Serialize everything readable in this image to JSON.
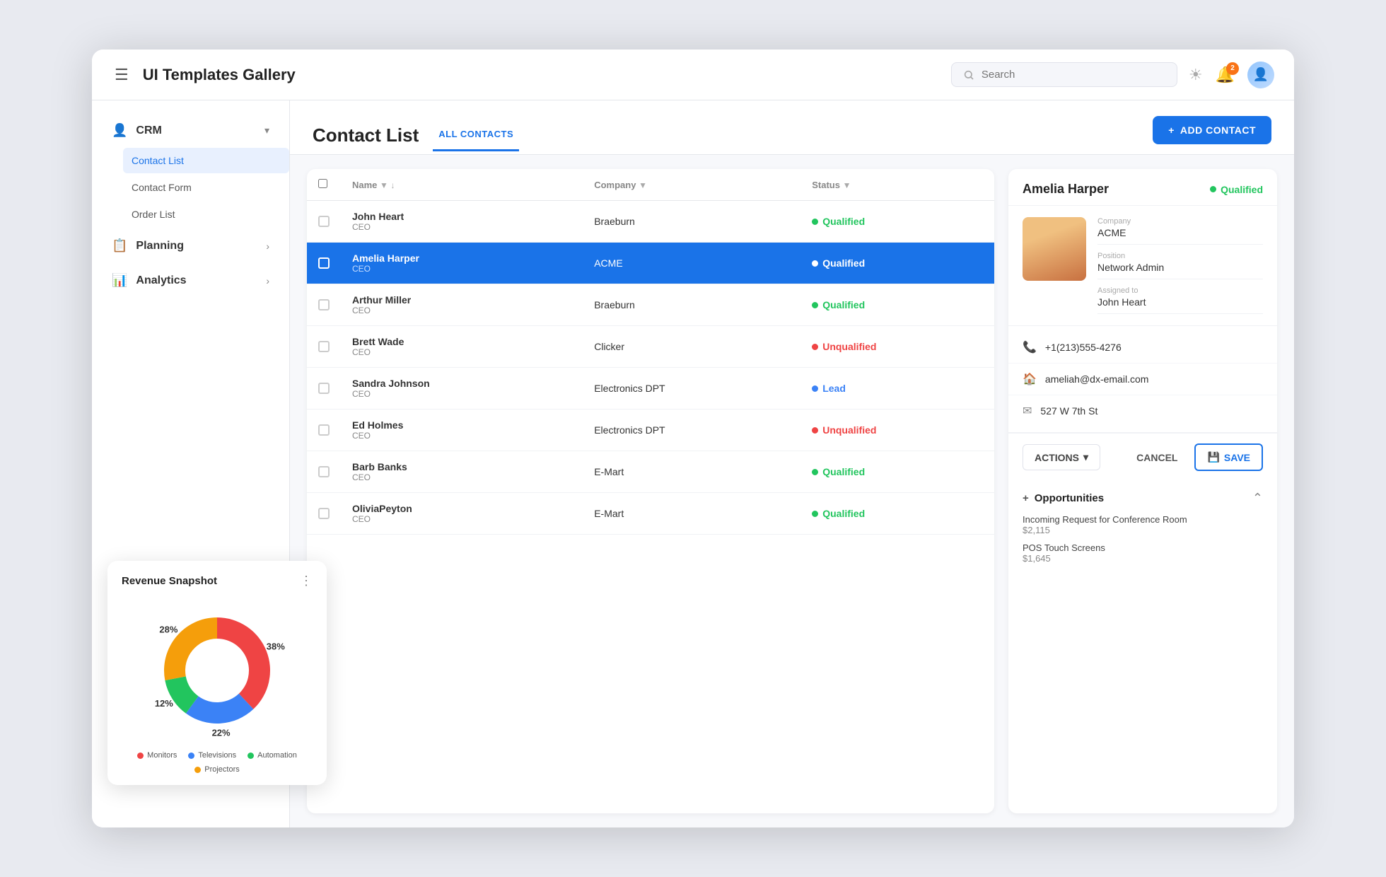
{
  "app": {
    "title": "UI Templates Gallery",
    "search_placeholder": "Search",
    "bell_badge": "2"
  },
  "sidebar": {
    "crm": {
      "label": "CRM",
      "items": [
        "Contact List",
        "Contact Form",
        "Order List"
      ]
    },
    "planning": {
      "label": "Planning"
    },
    "analytics": {
      "label": "Analytics"
    }
  },
  "main": {
    "title": "Contact List",
    "tab": "ALL CONTACTS",
    "add_button": "ADD CONTACT",
    "table": {
      "headers": [
        "Name",
        "Company",
        "Status"
      ],
      "rows": [
        {
          "name": "John Heart",
          "role": "CEO",
          "company": "Braeburn",
          "status": "Qualified",
          "status_type": "qualified"
        },
        {
          "name": "Amelia Harper",
          "role": "CEO",
          "company": "ACME",
          "status": "Qualified",
          "status_type": "qualified",
          "selected": true
        },
        {
          "name": "Arthur Miller",
          "role": "CEO",
          "company": "Braeburn",
          "status": "Qualified",
          "status_type": "qualified"
        },
        {
          "name": "Brett Wade",
          "role": "CEO",
          "company": "Clicker",
          "status": "Unqualified",
          "status_type": "unqualified"
        },
        {
          "name": "Sandra Johnson",
          "role": "CEO",
          "company": "Electronics DPT",
          "status": "Lead",
          "status_type": "lead"
        },
        {
          "name": "Ed Holmes",
          "role": "CEO",
          "company": "Electronics DPT",
          "status": "Unqualified",
          "status_type": "unqualified"
        },
        {
          "name": "Barb Banks",
          "role": "CEO",
          "company": "E-Mart",
          "status": "Qualified",
          "status_type": "qualified"
        },
        {
          "name": "OliviaPeyton",
          "role": "CEO",
          "company": "E-Mart",
          "status": "Qualified",
          "status_type": "qualified"
        }
      ]
    }
  },
  "detail": {
    "name": "Amelia Harper",
    "status": "Qualified",
    "company_label": "Company",
    "company_value": "ACME",
    "position_label": "Position",
    "position_value": "Network Admin",
    "assigned_label": "Assigned to",
    "assigned_value": "John Heart",
    "phone": "+1(213)555-4276",
    "email": "ameliah@dx-email.com",
    "address": "527 W 7th St",
    "actions_label": "ACTIONS",
    "cancel_label": "CANCEL",
    "save_label": "SAVE",
    "opportunities_title": "Opportunities",
    "opportunities": [
      {
        "name": "Incoming Request for Conference Room",
        "amount": "$2,115"
      },
      {
        "name": "POS Touch Screens",
        "amount": "$1,645"
      }
    ]
  },
  "revenue_widget": {
    "title": "Revenue Snapshot",
    "segments": [
      {
        "label": "Monitors",
        "color": "#ef4444",
        "pct": 38,
        "value": 38
      },
      {
        "label": "Televisions",
        "color": "#3b82f6",
        "pct": 22,
        "value": 22
      },
      {
        "label": "Automation",
        "color": "#22c55e",
        "pct": 12,
        "value": 12
      },
      {
        "label": "Projectors",
        "color": "#f59e0b",
        "pct": 28,
        "value": 28
      }
    ]
  }
}
